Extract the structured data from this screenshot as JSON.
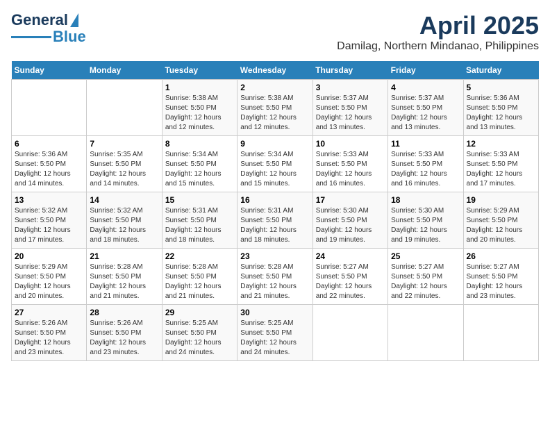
{
  "header": {
    "logo_line1": "General",
    "logo_line2": "Blue",
    "month_year": "April 2025",
    "location": "Damilag, Northern Mindanao, Philippines"
  },
  "days_of_week": [
    "Sunday",
    "Monday",
    "Tuesday",
    "Wednesday",
    "Thursday",
    "Friday",
    "Saturday"
  ],
  "weeks": [
    [
      {
        "day": "",
        "sunrise": "",
        "sunset": "",
        "daylight": ""
      },
      {
        "day": "",
        "sunrise": "",
        "sunset": "",
        "daylight": ""
      },
      {
        "day": "1",
        "sunrise": "Sunrise: 5:38 AM",
        "sunset": "Sunset: 5:50 PM",
        "daylight": "Daylight: 12 hours and 12 minutes."
      },
      {
        "day": "2",
        "sunrise": "Sunrise: 5:38 AM",
        "sunset": "Sunset: 5:50 PM",
        "daylight": "Daylight: 12 hours and 12 minutes."
      },
      {
        "day": "3",
        "sunrise": "Sunrise: 5:37 AM",
        "sunset": "Sunset: 5:50 PM",
        "daylight": "Daylight: 12 hours and 13 minutes."
      },
      {
        "day": "4",
        "sunrise": "Sunrise: 5:37 AM",
        "sunset": "Sunset: 5:50 PM",
        "daylight": "Daylight: 12 hours and 13 minutes."
      },
      {
        "day": "5",
        "sunrise": "Sunrise: 5:36 AM",
        "sunset": "Sunset: 5:50 PM",
        "daylight": "Daylight: 12 hours and 13 minutes."
      }
    ],
    [
      {
        "day": "6",
        "sunrise": "Sunrise: 5:36 AM",
        "sunset": "Sunset: 5:50 PM",
        "daylight": "Daylight: 12 hours and 14 minutes."
      },
      {
        "day": "7",
        "sunrise": "Sunrise: 5:35 AM",
        "sunset": "Sunset: 5:50 PM",
        "daylight": "Daylight: 12 hours and 14 minutes."
      },
      {
        "day": "8",
        "sunrise": "Sunrise: 5:34 AM",
        "sunset": "Sunset: 5:50 PM",
        "daylight": "Daylight: 12 hours and 15 minutes."
      },
      {
        "day": "9",
        "sunrise": "Sunrise: 5:34 AM",
        "sunset": "Sunset: 5:50 PM",
        "daylight": "Daylight: 12 hours and 15 minutes."
      },
      {
        "day": "10",
        "sunrise": "Sunrise: 5:33 AM",
        "sunset": "Sunset: 5:50 PM",
        "daylight": "Daylight: 12 hours and 16 minutes."
      },
      {
        "day": "11",
        "sunrise": "Sunrise: 5:33 AM",
        "sunset": "Sunset: 5:50 PM",
        "daylight": "Daylight: 12 hours and 16 minutes."
      },
      {
        "day": "12",
        "sunrise": "Sunrise: 5:33 AM",
        "sunset": "Sunset: 5:50 PM",
        "daylight": "Daylight: 12 hours and 17 minutes."
      }
    ],
    [
      {
        "day": "13",
        "sunrise": "Sunrise: 5:32 AM",
        "sunset": "Sunset: 5:50 PM",
        "daylight": "Daylight: 12 hours and 17 minutes."
      },
      {
        "day": "14",
        "sunrise": "Sunrise: 5:32 AM",
        "sunset": "Sunset: 5:50 PM",
        "daylight": "Daylight: 12 hours and 18 minutes."
      },
      {
        "day": "15",
        "sunrise": "Sunrise: 5:31 AM",
        "sunset": "Sunset: 5:50 PM",
        "daylight": "Daylight: 12 hours and 18 minutes."
      },
      {
        "day": "16",
        "sunrise": "Sunrise: 5:31 AM",
        "sunset": "Sunset: 5:50 PM",
        "daylight": "Daylight: 12 hours and 18 minutes."
      },
      {
        "day": "17",
        "sunrise": "Sunrise: 5:30 AM",
        "sunset": "Sunset: 5:50 PM",
        "daylight": "Daylight: 12 hours and 19 minutes."
      },
      {
        "day": "18",
        "sunrise": "Sunrise: 5:30 AM",
        "sunset": "Sunset: 5:50 PM",
        "daylight": "Daylight: 12 hours and 19 minutes."
      },
      {
        "day": "19",
        "sunrise": "Sunrise: 5:29 AM",
        "sunset": "Sunset: 5:50 PM",
        "daylight": "Daylight: 12 hours and 20 minutes."
      }
    ],
    [
      {
        "day": "20",
        "sunrise": "Sunrise: 5:29 AM",
        "sunset": "Sunset: 5:50 PM",
        "daylight": "Daylight: 12 hours and 20 minutes."
      },
      {
        "day": "21",
        "sunrise": "Sunrise: 5:28 AM",
        "sunset": "Sunset: 5:50 PM",
        "daylight": "Daylight: 12 hours and 21 minutes."
      },
      {
        "day": "22",
        "sunrise": "Sunrise: 5:28 AM",
        "sunset": "Sunset: 5:50 PM",
        "daylight": "Daylight: 12 hours and 21 minutes."
      },
      {
        "day": "23",
        "sunrise": "Sunrise: 5:28 AM",
        "sunset": "Sunset: 5:50 PM",
        "daylight": "Daylight: 12 hours and 21 minutes."
      },
      {
        "day": "24",
        "sunrise": "Sunrise: 5:27 AM",
        "sunset": "Sunset: 5:50 PM",
        "daylight": "Daylight: 12 hours and 22 minutes."
      },
      {
        "day": "25",
        "sunrise": "Sunrise: 5:27 AM",
        "sunset": "Sunset: 5:50 PM",
        "daylight": "Daylight: 12 hours and 22 minutes."
      },
      {
        "day": "26",
        "sunrise": "Sunrise: 5:27 AM",
        "sunset": "Sunset: 5:50 PM",
        "daylight": "Daylight: 12 hours and 23 minutes."
      }
    ],
    [
      {
        "day": "27",
        "sunrise": "Sunrise: 5:26 AM",
        "sunset": "Sunset: 5:50 PM",
        "daylight": "Daylight: 12 hours and 23 minutes."
      },
      {
        "day": "28",
        "sunrise": "Sunrise: 5:26 AM",
        "sunset": "Sunset: 5:50 PM",
        "daylight": "Daylight: 12 hours and 23 minutes."
      },
      {
        "day": "29",
        "sunrise": "Sunrise: 5:25 AM",
        "sunset": "Sunset: 5:50 PM",
        "daylight": "Daylight: 12 hours and 24 minutes."
      },
      {
        "day": "30",
        "sunrise": "Sunrise: 5:25 AM",
        "sunset": "Sunset: 5:50 PM",
        "daylight": "Daylight: 12 hours and 24 minutes."
      },
      {
        "day": "",
        "sunrise": "",
        "sunset": "",
        "daylight": ""
      },
      {
        "day": "",
        "sunrise": "",
        "sunset": "",
        "daylight": ""
      },
      {
        "day": "",
        "sunrise": "",
        "sunset": "",
        "daylight": ""
      }
    ]
  ]
}
